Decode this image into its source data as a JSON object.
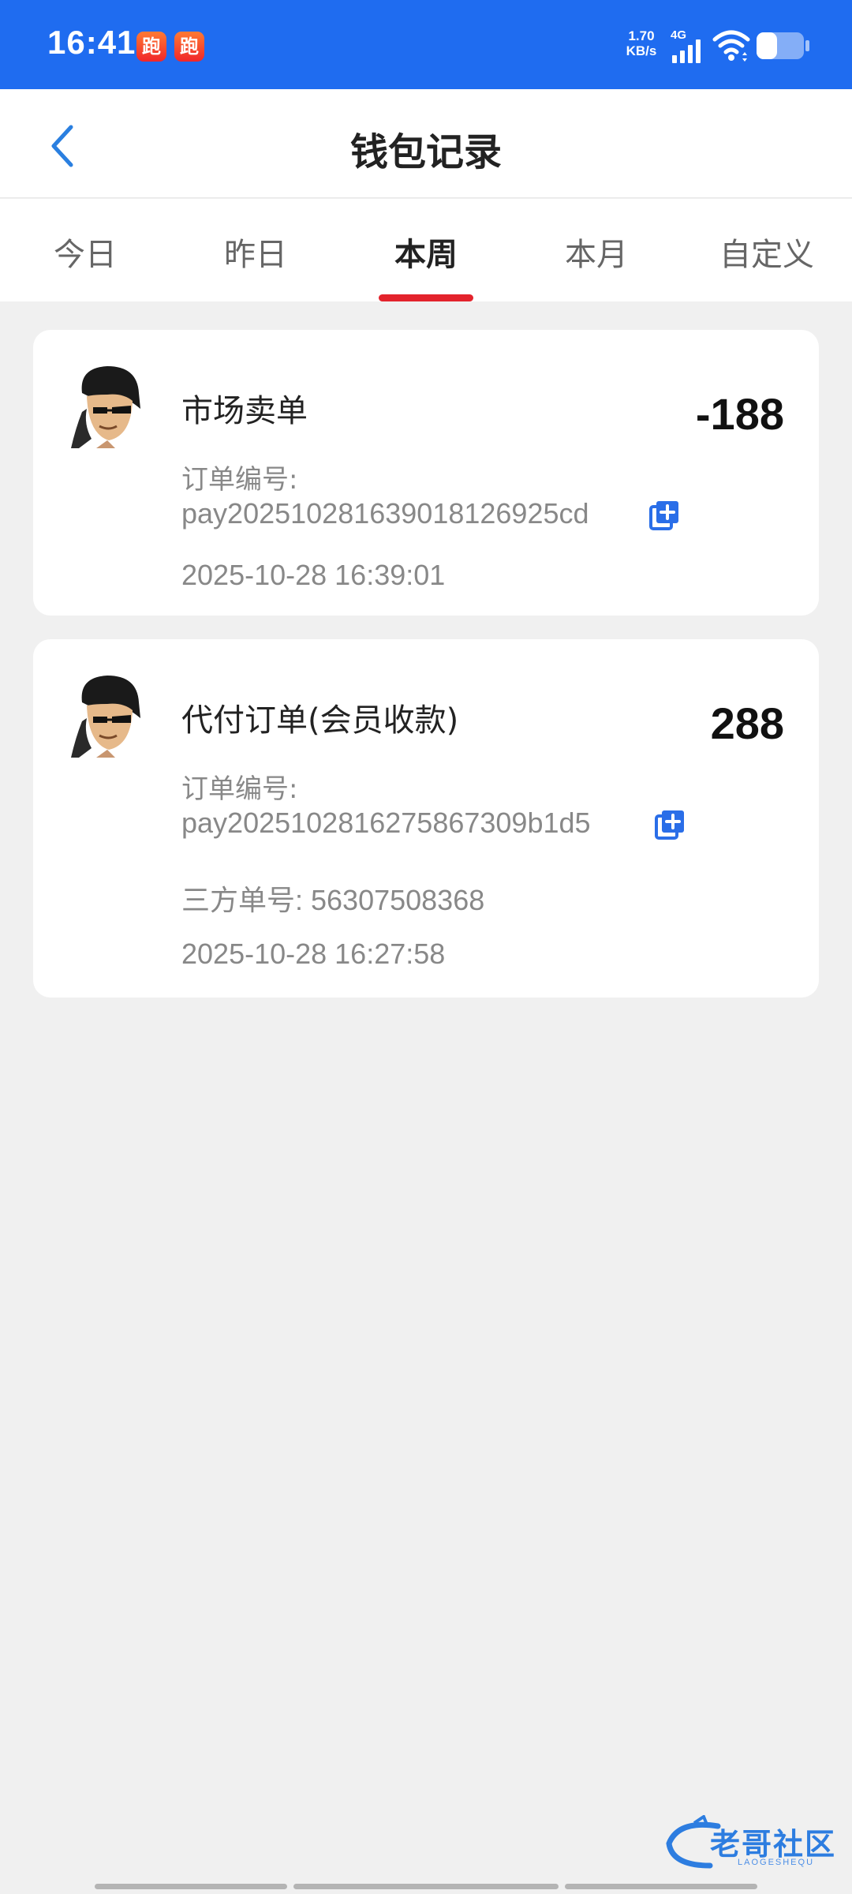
{
  "status_bar": {
    "time": "16:41",
    "app_badges": [
      "跑",
      "跑"
    ],
    "net_speed_value": "1.70",
    "net_speed_unit": "KB/s",
    "network_type": "4G",
    "signal_icon": "signal-icon",
    "wifi_icon": "wifi-icon",
    "battery_icon": "battery-icon"
  },
  "header": {
    "title": "钱包记录",
    "back_icon": "chevron-left-icon"
  },
  "tabs": [
    {
      "label": "今日",
      "active": false
    },
    {
      "label": "昨日",
      "active": false
    },
    {
      "label": "本周",
      "active": true
    },
    {
      "label": "本月",
      "active": false
    },
    {
      "label": "自定义",
      "active": false
    }
  ],
  "accent_colors": {
    "status_bar": "#1f6cf0",
    "tab_indicator": "#e3232c",
    "copy_icon": "#2a6ee8"
  },
  "records": [
    {
      "title": "市场卖单",
      "amount": "-188",
      "order_label": "订单编号:",
      "order_no": "pay202510281639018126925cd",
      "datetime": "2025-10-28 16:39:01"
    },
    {
      "title": "代付订单(会员收款)",
      "amount": "288",
      "order_label": "订单编号:",
      "order_no": "pay2025102816275867309b1d5",
      "third_party": "三方单号:  56307508368",
      "datetime": "2025-10-28 16:27:58"
    }
  ],
  "watermark": {
    "text": "老哥社区",
    "sub": "LAOGESHEQU"
  }
}
